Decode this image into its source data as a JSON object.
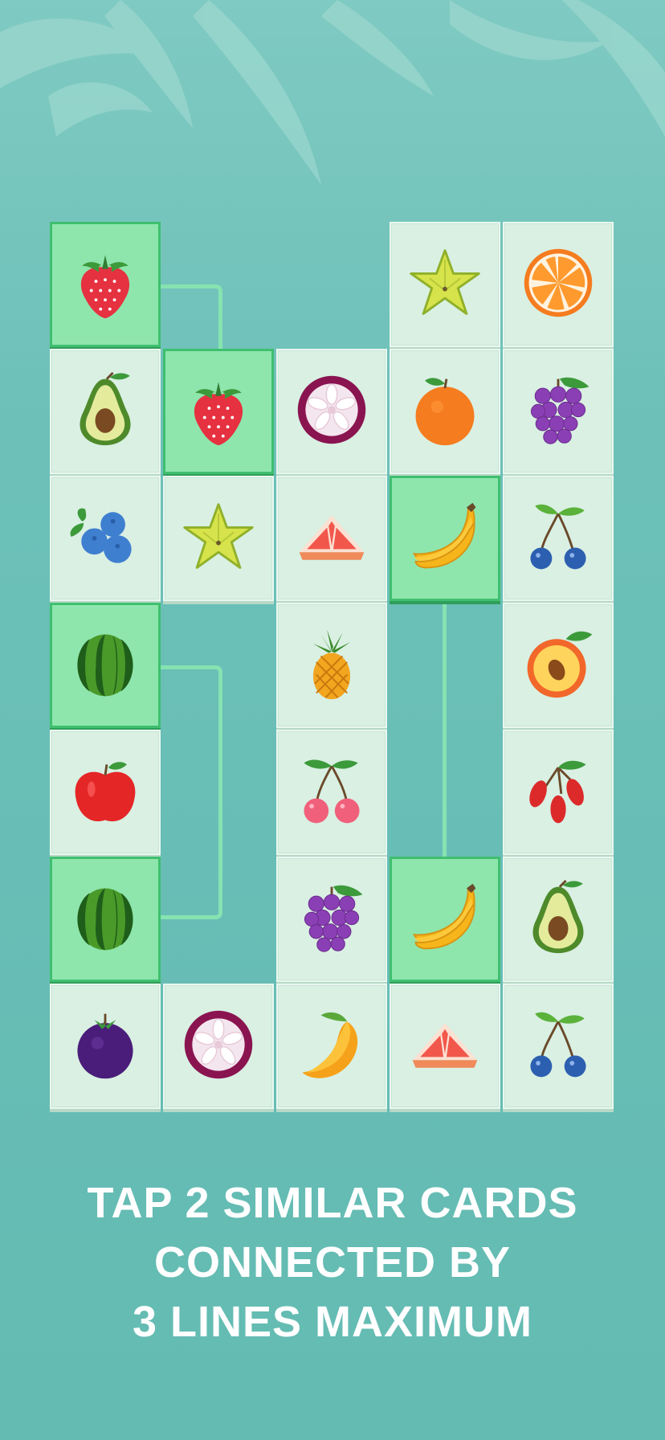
{
  "caption": {
    "line1": "TAP 2 SIMILAR CARDS",
    "line2": "CONNECTED BY",
    "line3": "3 LINES MAXIMUM"
  },
  "board": {
    "rows": 7,
    "cols": 5,
    "cells": [
      [
        "strawberry",
        null,
        null,
        "starfruit",
        "orange-slice"
      ],
      [
        "avocado",
        "strawberry",
        "mangosteen-half",
        "orange",
        "grapes"
      ],
      [
        "blueberries",
        "starfruit",
        "grapefruit-slice",
        "banana",
        "blue-cherries"
      ],
      [
        "watermelon",
        null,
        "pineapple",
        null,
        "peach-half"
      ],
      [
        "apple",
        null,
        "cherries",
        null,
        "goji-berries"
      ],
      [
        "watermelon",
        null,
        "grapes",
        "banana",
        "avocado"
      ],
      [
        "mangosteen",
        "mangosteen-half",
        "mango",
        "grapefruit-slice",
        "blue-cherries"
      ]
    ],
    "selected_pairs": [
      {
        "fruit": "strawberry",
        "cells": [
          [
            0,
            0
          ],
          [
            1,
            1
          ]
        ]
      },
      {
        "fruit": "watermelon",
        "cells": [
          [
            3,
            0
          ],
          [
            5,
            0
          ]
        ]
      },
      {
        "fruit": "banana",
        "cells": [
          [
            2,
            3
          ],
          [
            5,
            3
          ]
        ]
      }
    ],
    "colors": {
      "card": "#d9f0e3",
      "selected_card": "#8ee6ad",
      "selected_border": "#3fbf6f",
      "connector": "#86e3b1",
      "background": "#6cc0b8"
    }
  }
}
